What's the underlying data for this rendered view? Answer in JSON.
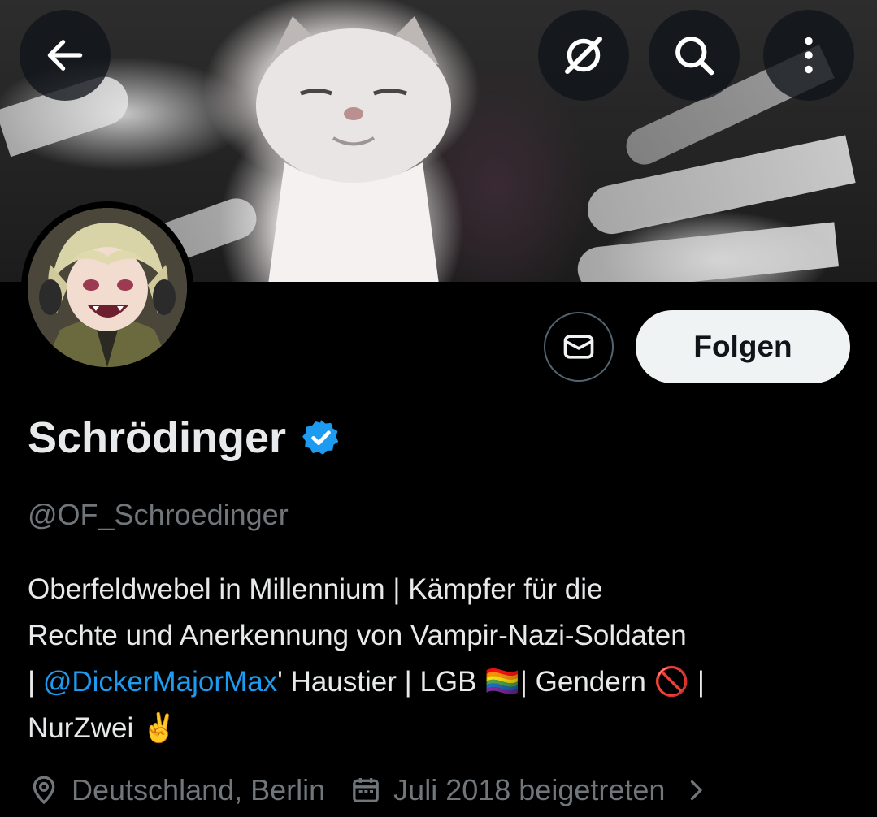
{
  "header": {
    "back_icon": "arrow-left-icon",
    "grok_icon": "grok-icon",
    "search_icon": "search-icon",
    "more_icon": "more-vertical-icon"
  },
  "profile": {
    "display_name": "Schrödinger",
    "verified_icon": "verified-badge-icon",
    "handle": "@OF_Schroedinger",
    "message_icon": "envelope-icon",
    "follow_label": "Folgen"
  },
  "bio": {
    "line1": "Oberfeldwebel in Millennium | Kämpfer für die",
    "line2": "Rechte und Anerkennung von Vampir-Nazi-Soldaten",
    "pre_mention": "| ",
    "mention": "@DickerMajorMax",
    "post_mention": "' Haustier | LGB ",
    "rainbow_flag": "🏳️‍🌈",
    "after_flag": "| Gendern ",
    "prohibited": "🚫",
    "after_prohibited": " |",
    "line4": "NurZwei ",
    "victory": "✌️"
  },
  "meta": {
    "location_icon": "location-pin-icon",
    "location": "Deutschland, Berlin",
    "calendar_icon": "calendar-icon",
    "joined": "Juli 2018 beigetreten",
    "chevron_icon": "chevron-right-icon"
  },
  "colors": {
    "background": "#000000",
    "accent": "#1d9bf0",
    "text": "#e7e9ea",
    "muted": "#71767b"
  }
}
